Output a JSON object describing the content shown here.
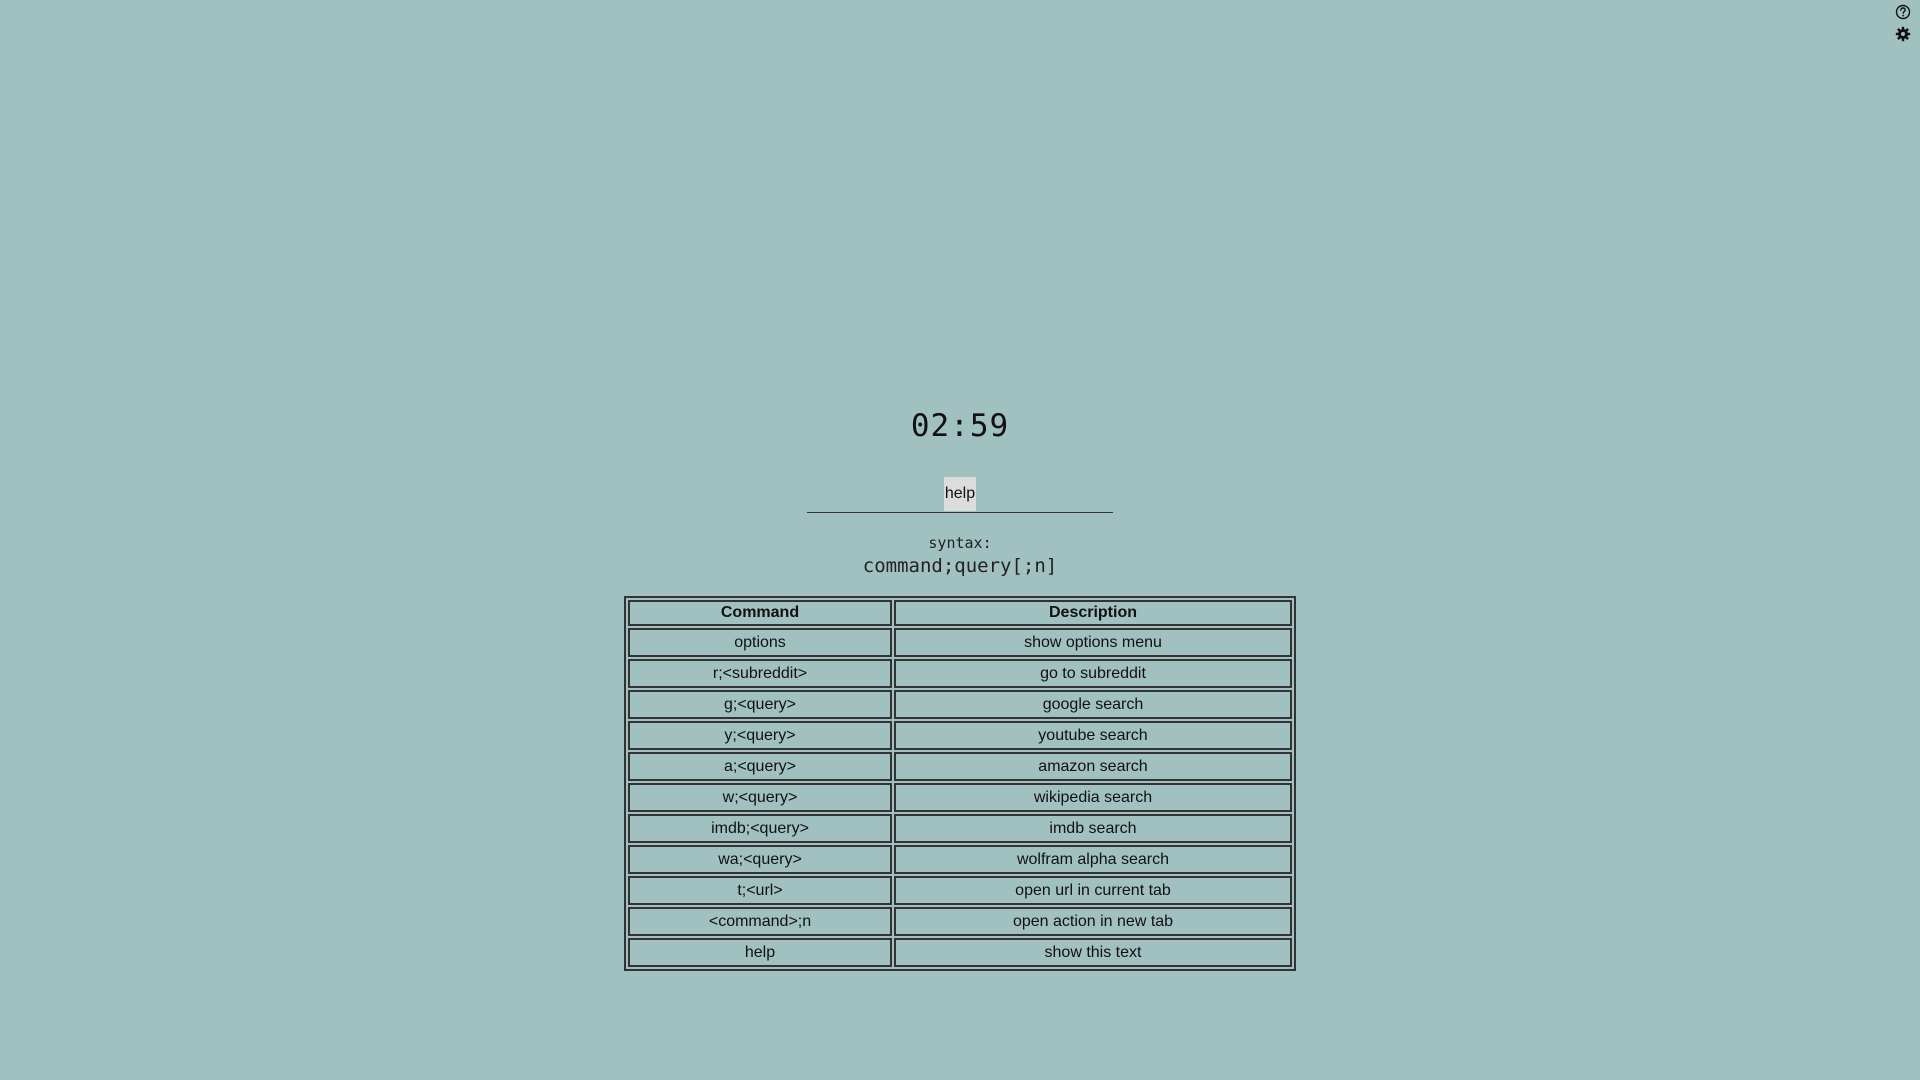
{
  "toolbar": {
    "help_icon": "question-circle",
    "settings_icon": "gear"
  },
  "clock": {
    "time": "02:59"
  },
  "search": {
    "value": "help"
  },
  "syntax": {
    "label": "syntax:",
    "value": "command;query[;n]"
  },
  "table": {
    "headers": {
      "command": "Command",
      "description": "Description"
    },
    "rows": [
      {
        "command": "options",
        "description": "show options menu"
      },
      {
        "command": "r;<subreddit>",
        "description": "go to subreddit"
      },
      {
        "command": "g;<query>",
        "description": "google search"
      },
      {
        "command": "y;<query>",
        "description": "youtube search"
      },
      {
        "command": "a;<query>",
        "description": "amazon search"
      },
      {
        "command": "w;<query>",
        "description": "wikipedia search"
      },
      {
        "command": "imdb;<query>",
        "description": "imdb search"
      },
      {
        "command": "wa;<query>",
        "description": "wolfram alpha search"
      },
      {
        "command": "t;<url>",
        "description": "open url in current tab"
      },
      {
        "command": "<command>;n",
        "description": "open action in new tab"
      },
      {
        "command": "help",
        "description": "show this text"
      }
    ]
  },
  "colors": {
    "background": "#a1c0c0",
    "text": "#111111",
    "border": "#333333",
    "search_highlight": "#dcdcdc"
  }
}
